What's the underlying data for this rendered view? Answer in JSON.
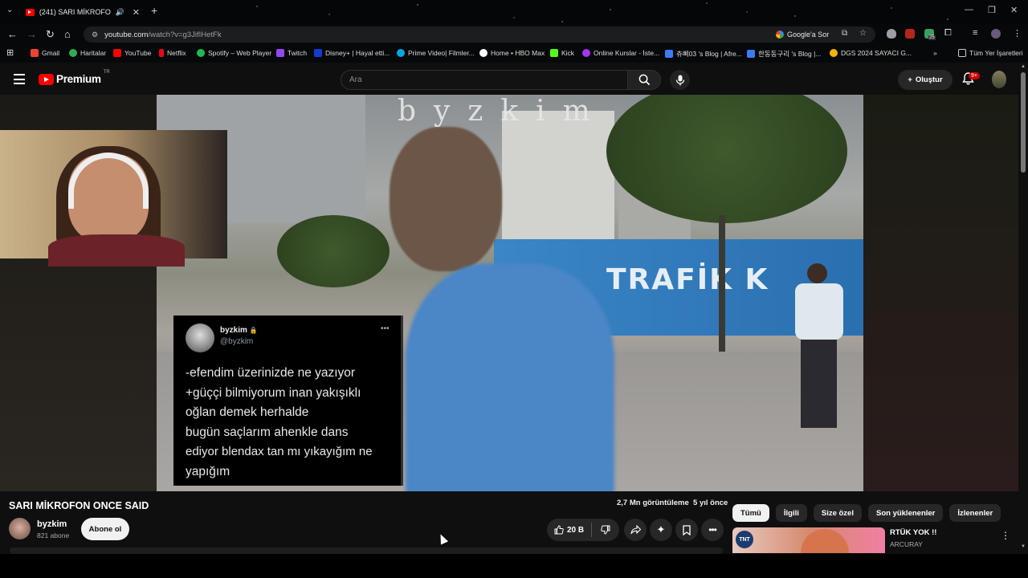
{
  "browser": {
    "tab": {
      "title": "(241) SARI MİKROFON ONCE SAID"
    },
    "url": {
      "domain": "youtube.com",
      "path": "/watch?v=g3JifIHetFk"
    },
    "google_ask": "Google'a Sor",
    "extension_badge": "25",
    "bookmarks": [
      {
        "label": "Gmail",
        "color": "#ea4335"
      },
      {
        "label": "Haritalar",
        "color": "#34a853"
      },
      {
        "label": "YouTube",
        "color": "#ff0000"
      },
      {
        "label": "Netflix",
        "color": "#e50914"
      },
      {
        "label": "Spotify – Web Player",
        "color": "#1db954"
      },
      {
        "label": "Twitch",
        "color": "#9146ff"
      },
      {
        "label": "Disney+ | Hayal etti...",
        "color": "#113ccf"
      },
      {
        "label": "Prime Video| Filmler...",
        "color": "#00a8e1"
      },
      {
        "label": "Home • HBO Max",
        "color": "#ffffff"
      },
      {
        "label": "Kick",
        "color": "#53fc18"
      },
      {
        "label": "Online Kurslar - İste...",
        "color": "#a435f0"
      },
      {
        "label": "츄삐03 's Blog | Afre...",
        "color": "#3d7bf6"
      },
      {
        "label": "한동동구리 's Blog |...",
        "color": "#3d7bf6"
      },
      {
        "label": "DGS 2024 SAYACI G...",
        "color": "#f4b400"
      }
    ],
    "all_bookmarks": "Tüm Yer İşaretleri"
  },
  "header": {
    "logo_text": "Premium",
    "logo_region": "TR",
    "search_placeholder": "Ara",
    "create_label": "Oluştur",
    "notification_count": "9+"
  },
  "video": {
    "watermark": "byzkim",
    "banner_text": "TRAFİK K",
    "tweet": {
      "name": "byzkim",
      "handle": "@byzkim",
      "lines": [
        "-efendim üzerinizde ne yazıyor",
        "+güççi bilmiyorum inan yakışıklı",
        "oğlan demek herhalde",
        "bugün saçlarım ahenkle dans",
        "ediyor blendax tan mı yıkayığım ne",
        "yapığım"
      ]
    }
  },
  "meta": {
    "title": "SARI MİKROFON ONCE SAID",
    "views": "2,7 Mn görüntüleme",
    "age": "5 yıl önce",
    "channel": "byzkim",
    "subscribers": "821 abone",
    "subscribe_label": "Abone ol",
    "likes": "20 B"
  },
  "sidebar": {
    "chips": [
      "Tümü",
      "İlgili",
      "Size özel",
      "Son yüklenenler",
      "İzlenenler"
    ],
    "rec": {
      "title": "RTÜK YOK !!",
      "channel": "ARCURAY",
      "thumb_logo": "TNT"
    }
  }
}
